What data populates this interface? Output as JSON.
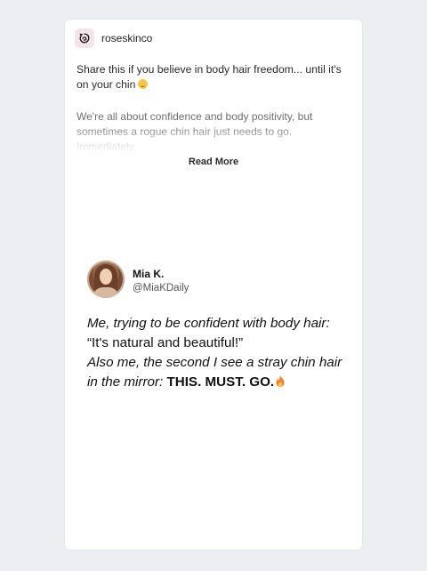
{
  "post": {
    "brand_name": "roseskinco",
    "brand_logo_icon": "rose-icon",
    "caption_text": "Share this if you believe in body hair freedom... until it's on your chin",
    "caption_emoji": "grimace-smile-emoji",
    "body_text": "We're all about confidence and body positivity, but sometimes a rogue chin hair just needs to go. Immediately.",
    "read_more_label": "Read More"
  },
  "tweet": {
    "name": "Mia K.",
    "handle": "@MiaKDaily",
    "line1_italic": "Me, trying to be confident with body hair: ",
    "line1_quote": "“It's natural and beautiful!”",
    "line2_italic": "Also me, the second I see a stray chin hair in the mirror: ",
    "line2_caps": "THIS. MUST. GO.",
    "end_emoji": "fire-emoji"
  }
}
